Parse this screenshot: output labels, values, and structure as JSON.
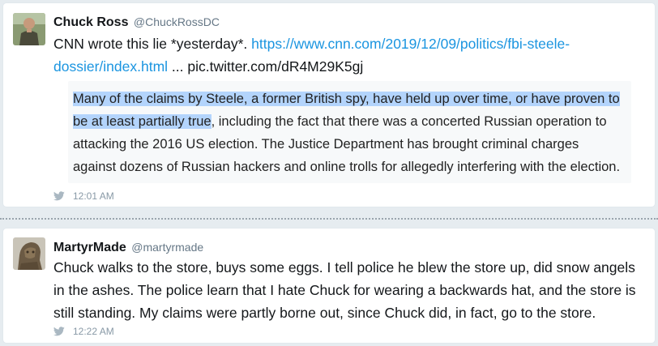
{
  "colors": {
    "background": "#e6ecf0",
    "link": "#1b95e0",
    "highlight": "#b3d4fc",
    "meta": "#8899a6"
  },
  "tweets": [
    {
      "author_name": "Chuck Ross",
      "author_handle": "@ChuckRossDC",
      "avatar_icon": "person-photo-avatar",
      "text_prefix": "CNN wrote this lie *yesterday*. ",
      "link": "https://www.cnn.com/2019/12/09/politics/fbi-steele-dossier/index.html",
      "text_suffix": " ... pic.twitter.com/dR4M29K5gj",
      "quote_highlighted": "Many of the claims by Steele, a former British spy, have held up over time, or have proven to be at least partially true",
      "quote_rest": ", including the fact that there was a concerted Russian operation to attacking the 2016 US election. The Justice Department has brought criminal charges against dozens of Russian hackers and online trolls for allegedly interfering with the election.",
      "time": "12:01 AM",
      "time_icon": "twitter-bird-icon"
    },
    {
      "author_name": "MartyrMade",
      "author_handle": "@martyrmade",
      "avatar_icon": "statue-avatar",
      "text": "Chuck walks to the store, buys some eggs. I tell police he blew the store up, did snow angels in the ashes. The police learn that I hate Chuck for wearing a backwards hat, and the store is still standing. My claims were partly borne out, since Chuck did, in fact, go to the store.",
      "time": "12:22 AM",
      "time_icon": "twitter-bird-icon"
    }
  ]
}
